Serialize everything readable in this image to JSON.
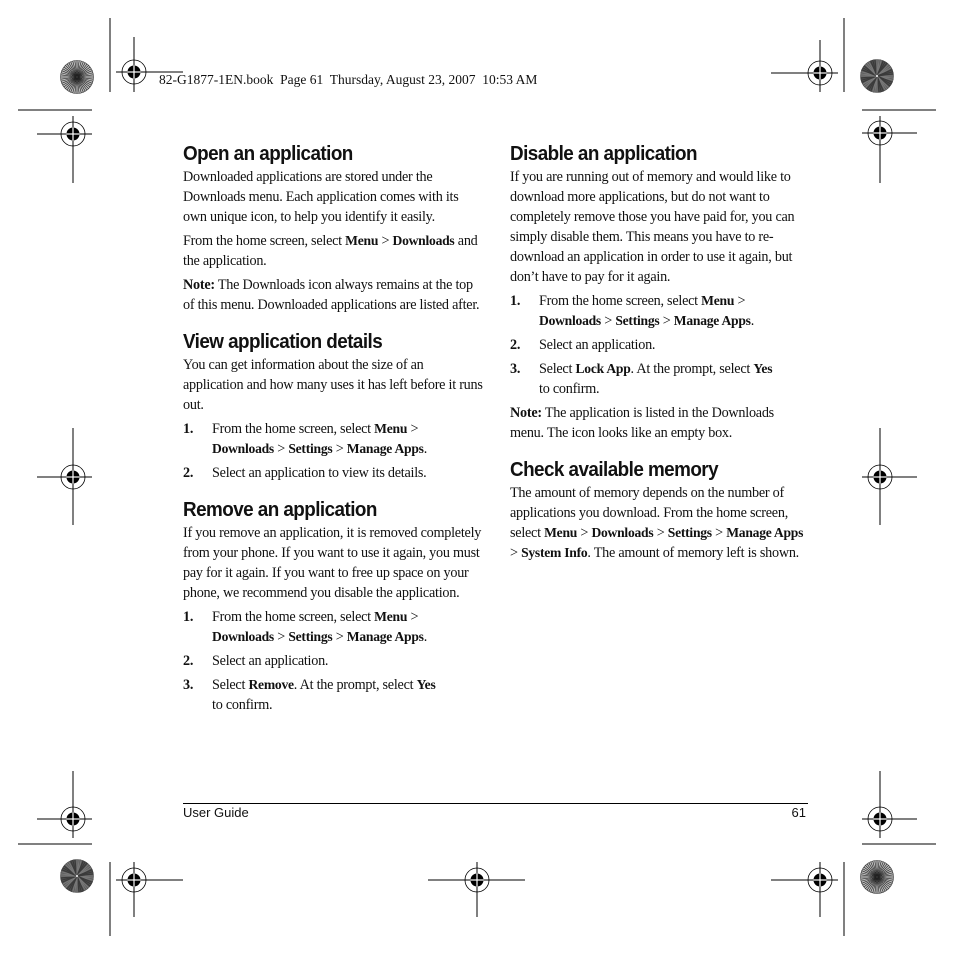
{
  "slug": "82-G1877-1EN.book  Page 61  Thursday, August 23, 2007  10:53 AM",
  "sections": {
    "open": {
      "title": "Open an application",
      "p1": "Downloaded applications are stored under the Downloads menu. Each application comes with its own unique icon, to help you identify it easily.",
      "p2_pre": "From the home screen, select ",
      "p2_menu": "Menu",
      "p2_sep": " > ",
      "p2_downloads": "Downloads",
      "p2_post": " and the application.",
      "note_label": "Note:",
      "note_text": " The Downloads icon always remains at the top of this menu. Downloaded applications are listed after."
    },
    "view": {
      "title": "View application details",
      "p1": "You can get information about the size of an application and how many uses it has left before it runs out.",
      "steps": [
        {
          "num": "1.",
          "pre": "From the home screen, select ",
          "b1": "Menu",
          "s1": " > ",
          "b2": "Downloads",
          "s2": " > ",
          "b3": "Settings",
          "s3": " > ",
          "b4": "Manage Apps",
          "post": "."
        },
        {
          "num": "2.",
          "text": "Select an application to view its details."
        }
      ]
    },
    "remove": {
      "title": "Remove an application",
      "p1": "If you remove an application, it is removed completely from your phone. If you want to use it again, you must pay for it again. If you want to free up space on your phone, we recommend you disable the application.",
      "steps": [
        {
          "num": "1.",
          "pre": "From the home screen, select ",
          "b1": "Menu",
          "s1": " > ",
          "b2": "Downloads",
          "s2": " > ",
          "b3": "Settings",
          "s3": " > ",
          "b4": "Manage Apps",
          "post": "."
        },
        {
          "num": "2.",
          "text": "Select an application."
        },
        {
          "num": "3.",
          "pre": "Select ",
          "b1": "Remove",
          "mid": ". At the prompt, select ",
          "b2": "Yes",
          "post": " to confirm."
        }
      ]
    },
    "disable": {
      "title": "Disable an application",
      "p1": "If you are running out of memory and would like to download more applications, but do not want to completely remove those you have paid for, you can simply disable them. This means you have to re-download an application in order to use it again, but don’t have to pay for it again.",
      "steps": [
        {
          "num": "1.",
          "pre": "From the home screen, select ",
          "b1": "Menu",
          "s1": " > ",
          "b2": "Downloads",
          "s2": " > ",
          "b3": "Settings",
          "s3": " > ",
          "b4": "Manage Apps",
          "post": "."
        },
        {
          "num": "2.",
          "text": "Select an application."
        },
        {
          "num": "3.",
          "pre": "Select ",
          "b1": "Lock App",
          "mid": ". At the prompt, select ",
          "b2": "Yes",
          "post": " to confirm."
        }
      ],
      "note_label": "Note:",
      "note_text": " The application is listed in the Downloads menu. The icon looks like an empty box."
    },
    "memory": {
      "title": "Check available memory",
      "pre": "The amount of memory depends on the number of applications you download. From the home screen, select ",
      "b1": "Menu",
      "s1": " > ",
      "b2": "Downloads",
      "s2": " > ",
      "b3": "Settings",
      "s3": " > ",
      "b4": "Manage Apps",
      "s4": " > ",
      "b5": "System Info",
      "post": ". The amount of memory left is shown."
    }
  },
  "footer": {
    "left": "User Guide",
    "page_number": "61"
  }
}
